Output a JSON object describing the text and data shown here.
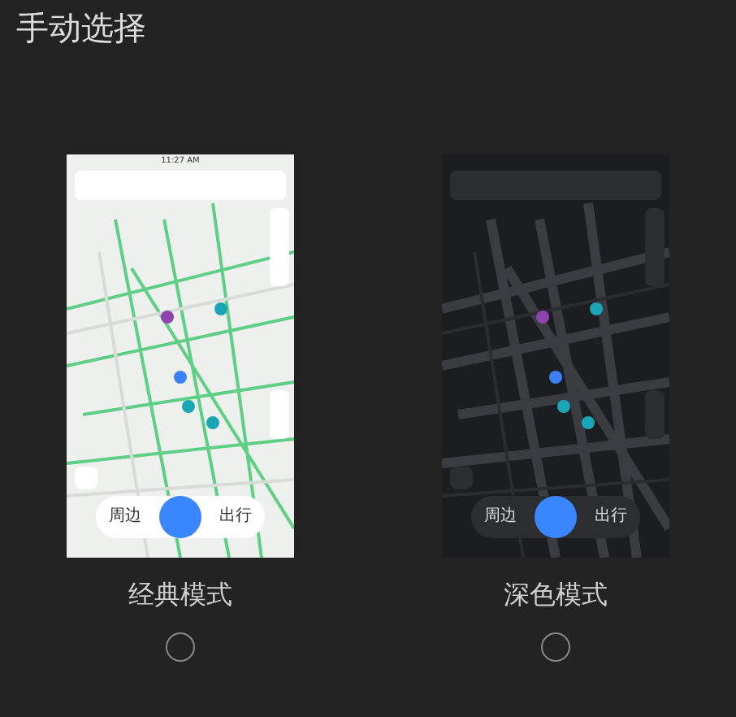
{
  "title": "手动选择",
  "modes": [
    {
      "kind": "light",
      "label": "经典模式",
      "selected": false,
      "status_time": "11:27 AM",
      "nav": [
        "周边",
        "出行"
      ]
    },
    {
      "kind": "dark",
      "label": "深色模式",
      "selected": false,
      "nav": [
        "周边",
        "出行"
      ]
    }
  ]
}
